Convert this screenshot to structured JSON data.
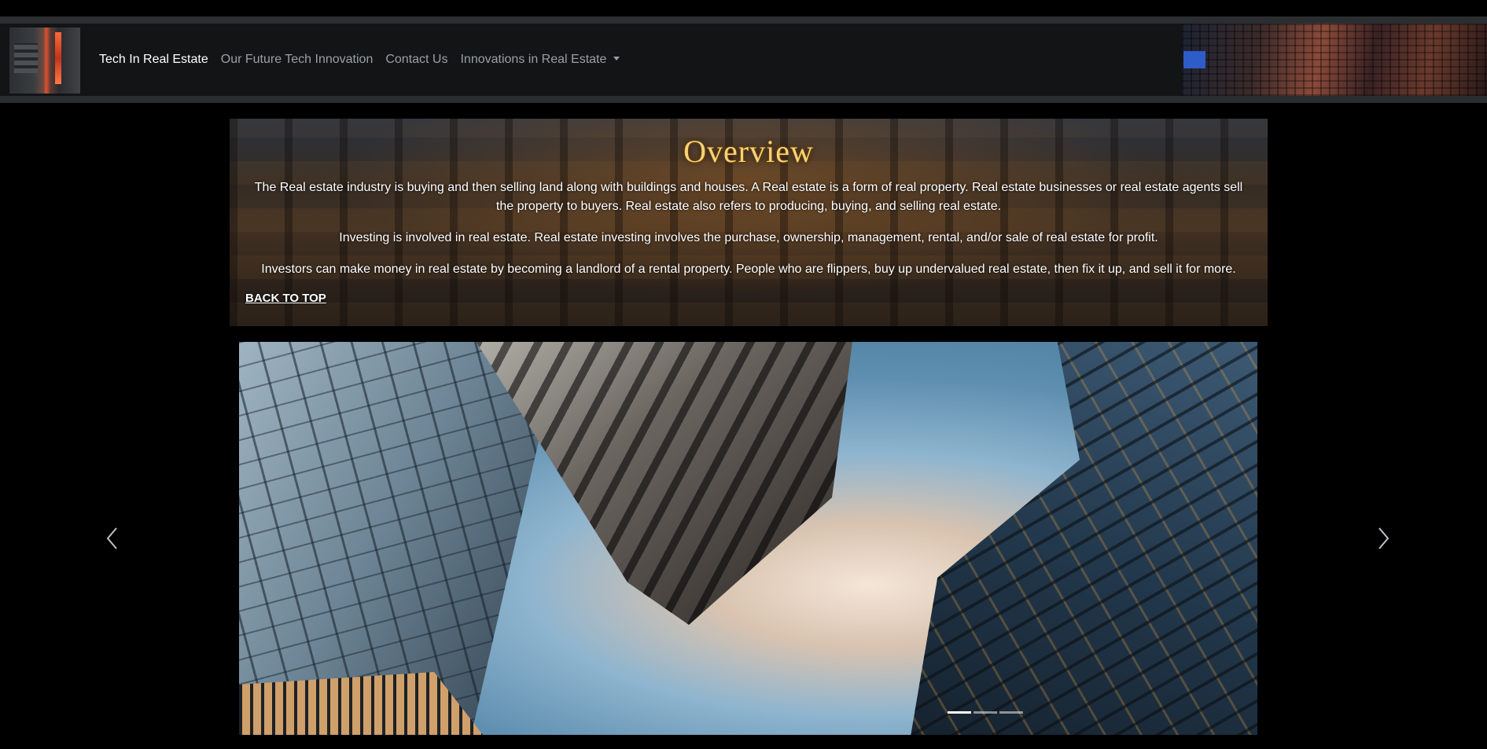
{
  "navbar": {
    "links": [
      {
        "label": "Tech In Real Estate",
        "active": true
      },
      {
        "label": "Our Future Tech Innovation",
        "active": false
      },
      {
        "label": "Contact Us",
        "active": false
      },
      {
        "label": "Innovations in Real Estate",
        "active": false,
        "dropdown": true
      }
    ]
  },
  "overview": {
    "title": "Overview",
    "paragraphs": [
      "The Real estate industry is buying and then selling land along with buildings and houses. A Real estate is a form of real property. Real estate businesses or real estate agents sell the property to buyers. Real estate also refers to producing, buying, and selling real estate.",
      "Investing is involved in real estate. Real estate investing involves the purchase, ownership, management, rental, and/or sale of real estate for profit.",
      "Investors can make money in real estate by becoming a landlord of a rental property. People who are flippers, buy up undervalued real estate, then fix it up, and sell it for more."
    ],
    "back_to_top": "BACK TO TOP"
  },
  "carousel": {
    "slide_count": 3,
    "active_index": 0,
    "prev_icon": "chevron-left-icon",
    "next_icon": "chevron-right-icon"
  },
  "colors": {
    "page_bg": "#000000",
    "navbar_bg": "#121416",
    "title_gold": "#f3d37a",
    "link_muted": "#9aa0a6"
  }
}
